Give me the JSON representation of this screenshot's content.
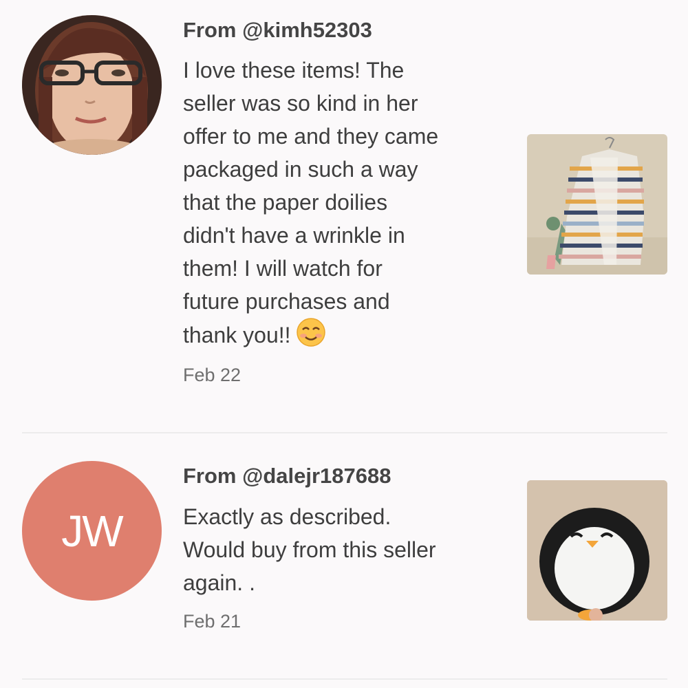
{
  "reviews": [
    {
      "reviewer": "From @kimh52303",
      "text": "I love these items! The\nseller was so kind in her\noffer to me and they came\npackaged in such a way\nthat the paper doilies\ndidn't have a wrinkle in\nthem! I will watch for\nfuture purchases and\nthank you!!",
      "emoji_icon": "smiling-face-icon",
      "date": "Feb 22",
      "avatar_type": "photo",
      "thumbnail": "striped-cardigan-photo"
    },
    {
      "reviewer": "From @dalejr187688",
      "text": "Exactly as described.\nWould buy from this seller\nagain. .",
      "date": "Feb 21",
      "avatar_type": "initials",
      "avatar_initials": "JW",
      "avatar_color": "#df7f6e",
      "thumbnail": "penguin-plush-photo"
    }
  ],
  "colors": {
    "background": "#fbf9fa",
    "divider": "#ececec",
    "reviewer_text": "#454545",
    "body_text": "#3e3e3e",
    "date_text": "#6e6e6e"
  }
}
